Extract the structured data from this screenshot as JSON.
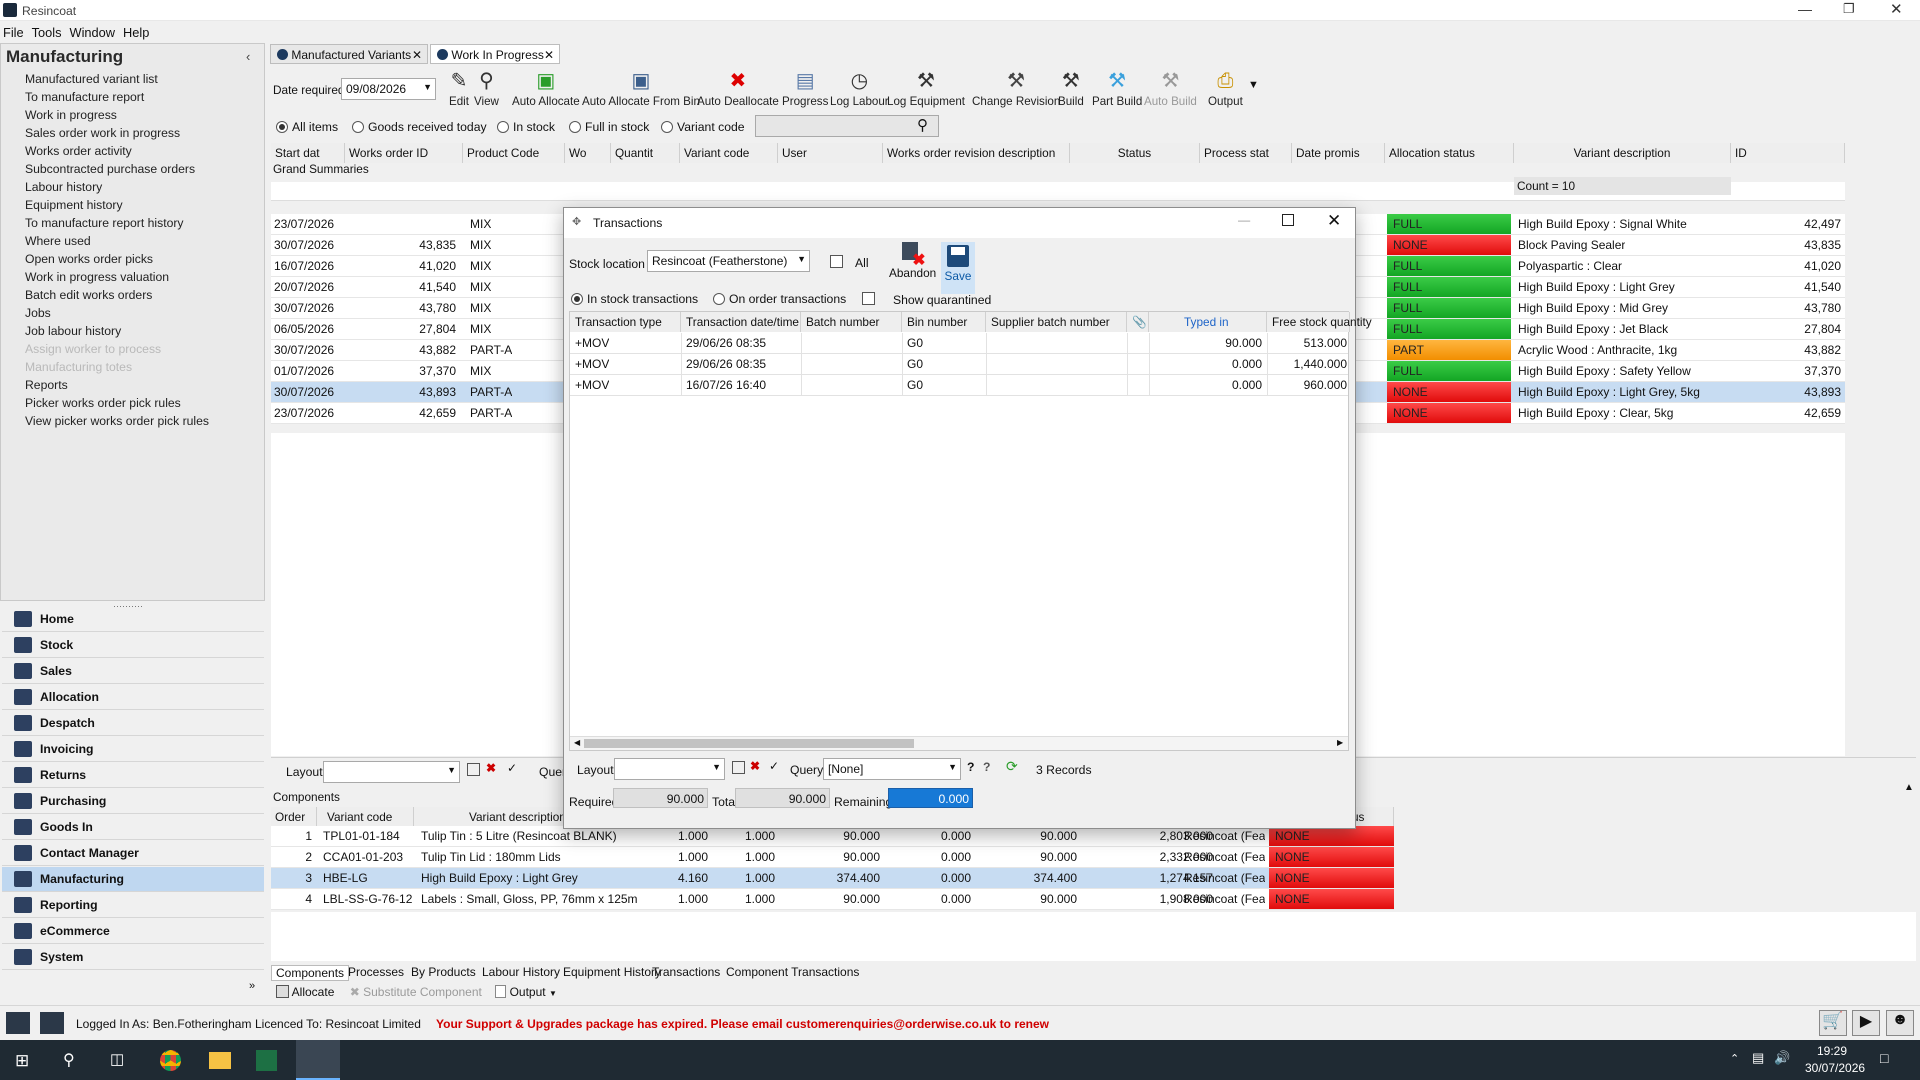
{
  "window": {
    "title": "Resincoat"
  },
  "menu": [
    "File",
    "Tools",
    "Window",
    "Help"
  ],
  "left": {
    "title": "Manufacturing",
    "items": [
      "Manufactured variant list",
      "To manufacture report",
      "Work in progress",
      "Sales order work in progress",
      "Works order activity",
      "Subcontracted purchase orders",
      "Labour history",
      "Equipment history",
      "To manufacture report history",
      "Where used",
      "Open works order picks",
      "Work in progress valuation",
      "Batch edit works orders",
      "Jobs",
      "Job labour history",
      "Assign worker to process",
      "Manufacturing totes",
      "Reports",
      "Picker works order pick rules",
      "View picker works order pick rules"
    ],
    "disabled": [
      15,
      16
    ],
    "modules": [
      "Home",
      "Stock",
      "Sales",
      "Allocation",
      "Despatch",
      "Invoicing",
      "Returns",
      "Purchasing",
      "Goods In",
      "Contact Manager",
      "Manufacturing",
      "Reporting",
      "eCommerce",
      "System"
    ]
  },
  "tabs": [
    "Manufactured Variants",
    "Work In Progress"
  ],
  "toolbar": {
    "date_label": "Date required",
    "date_value": "09/08/2026",
    "buttons": [
      "Edit",
      "View",
      "Auto Allocate",
      "Auto Allocate From Bin",
      "Auto Deallocate",
      "Progress",
      "Log Labour",
      "Log Equipment",
      "Change Revision",
      "Build",
      "Part Build",
      "Auto Build",
      "Output"
    ]
  },
  "filters": [
    "All items",
    "Goods received today",
    "In stock",
    "Full in stock",
    "Variant code"
  ],
  "grid": {
    "headers": [
      "Start dat",
      "Works order ID",
      "Product Code",
      "Wo",
      "Quantit",
      "Variant code",
      "User",
      "Works order revision description",
      "Status",
      "Process stat",
      "Date promis",
      "Allocation status",
      "Variant description",
      "ID"
    ],
    "grand": "Grand Summaries",
    "count": "Count = 10",
    "rows": [
      {
        "date": "23/07/2026",
        "woid": "",
        "code": "MIX",
        "alloc": "FULL",
        "color": "green",
        "desc": "High Build Epoxy : Signal White",
        "id": "42,497"
      },
      {
        "date": "30/07/2026",
        "woid": "43,835",
        "code": "MIX",
        "alloc": "NONE",
        "color": "red",
        "desc": "Block Paving Sealer",
        "id": "43,835"
      },
      {
        "date": "16/07/2026",
        "woid": "41,020",
        "code": "MIX",
        "alloc": "FULL",
        "color": "green",
        "desc": "Polyaspartic : Clear",
        "id": "41,020"
      },
      {
        "date": "20/07/2026",
        "woid": "41,540",
        "code": "MIX",
        "alloc": "FULL",
        "color": "green",
        "desc": "High Build Epoxy : Light Grey",
        "id": "41,540"
      },
      {
        "date": "30/07/2026",
        "woid": "43,780",
        "code": "MIX",
        "alloc": "FULL",
        "color": "green",
        "desc": "High Build Epoxy : Mid Grey",
        "id": "43,780"
      },
      {
        "date": "06/05/2026",
        "woid": "27,804",
        "code": "MIX",
        "alloc": "FULL",
        "color": "green",
        "desc": "High Build Epoxy : Jet Black",
        "id": "27,804"
      },
      {
        "date": "30/07/2026",
        "woid": "43,882",
        "code": "PART-A",
        "alloc": "PART",
        "color": "orange",
        "desc": "Acrylic Wood : Anthracite, 1kg",
        "id": "43,882"
      },
      {
        "date": "01/07/2026",
        "woid": "37,370",
        "code": "MIX",
        "alloc": "FULL",
        "color": "green",
        "desc": "High Build Epoxy : Safety Yellow",
        "id": "37,370"
      },
      {
        "date": "30/07/2026",
        "woid": "43,893",
        "code": "PART-A",
        "alloc": "NONE",
        "color": "red",
        "desc": "High Build Epoxy : Light Grey, 5kg",
        "id": "43,893"
      },
      {
        "date": "23/07/2026",
        "woid": "42,659",
        "code": "PART-A",
        "alloc": "NONE",
        "color": "red",
        "desc": "High Build Epoxy : Clear, 5kg",
        "id": "42,659"
      }
    ],
    "selected": 8
  },
  "layout_label": "Layout:",
  "query_label": "Quer",
  "components": {
    "title": "Components",
    "headers": [
      "Order",
      "Variant code",
      "Variant description",
      "us"
    ],
    "rows": [
      {
        "order": "1",
        "code": "TPL01-01-184",
        "desc": "Tulip Tin : 5 Litre (Resincoat BLANK)",
        "a": "1.000",
        "b": "1.000",
        "c": "90.000",
        "d": "0.000",
        "e": "90.000",
        "f": "2,803.000",
        "loc": "Resincoat (Fea",
        "st": "NONE"
      },
      {
        "order": "2",
        "code": "CCA01-01-203",
        "desc": "Tulip Tin Lid : 180mm Lids",
        "a": "1.000",
        "b": "1.000",
        "c": "90.000",
        "d": "0.000",
        "e": "90.000",
        "f": "2,332.000",
        "loc": "Resincoat (Fea",
        "st": "NONE"
      },
      {
        "order": "3",
        "code": "HBE-LG",
        "desc": "High Build Epoxy : Light Grey",
        "a": "4.160",
        "b": "1.000",
        "c": "374.400",
        "d": "0.000",
        "e": "374.400",
        "f": "1,274.157",
        "loc": "Resincoat (Fea",
        "st": "NONE"
      },
      {
        "order": "4",
        "code": "LBL-SS-G-76-12",
        "desc": "Labels : Small, Gloss, PP, 76mm x 125m",
        "a": "1.000",
        "b": "1.000",
        "c": "90.000",
        "d": "0.000",
        "e": "90.000",
        "f": "1,908.000",
        "loc": "Resincoat (Fea",
        "st": "NONE"
      }
    ],
    "selected": 2,
    "tabs": [
      "Components",
      "Processes",
      "By Products",
      "Labour History",
      "Equipment History",
      "Transactions",
      "Component Transactions"
    ],
    "actions": [
      "Allocate",
      "Substitute Component",
      "Output"
    ]
  },
  "dialog": {
    "title": "Transactions",
    "stock_label": "Stock location",
    "stock_value": "Resincoat (Featherstone)",
    "all_label": "All",
    "abandon": "Abandon",
    "save": "Save",
    "radio": [
      "In stock transactions",
      "On order transactions"
    ],
    "quarantine": "Show quarantined",
    "headers": [
      "Transaction type",
      "Transaction date/time",
      "Batch number",
      "Bin number",
      "Supplier batch number",
      "",
      "Typed in",
      "Free stock quantity"
    ],
    "rows": [
      {
        "type": "+MOV",
        "dt": "29/06/26 08:35",
        "batch": "",
        "bin": "G0",
        "sup": "",
        "typed": "90.000",
        "free": "513.000"
      },
      {
        "type": "+MOV",
        "dt": "29/06/26 08:35",
        "batch": "",
        "bin": "G0",
        "sup": "",
        "typed": "0.000",
        "free": "1,440.000"
      },
      {
        "type": "+MOV",
        "dt": "16/07/26 16:40",
        "batch": "",
        "bin": "G0",
        "sup": "",
        "typed": "0.000",
        "free": "960.000"
      }
    ],
    "layout": "Layout:",
    "query": "Query:",
    "query_value": "[None]",
    "records": "3 Records",
    "required_label": "Required",
    "required": "90.000",
    "total_label": "Total",
    "total": "90.000",
    "remaining_label": "Remaining",
    "remaining": "0.000"
  },
  "status": {
    "user": "Logged In As: Ben.Fotheringham",
    "licence": "Licenced To: Resincoat Limited",
    "warning": "Your Support & Upgrades package has expired. Please email customerenquiries@orderwise.co.uk to renew"
  },
  "clock": {
    "time": "19:29",
    "date": "30/07/2026"
  },
  "colors": {
    "accent": "#0078d7",
    "full": "#22b430",
    "none": "#ee1c1c",
    "part": "#f6a21c",
    "selected": "#c7dcf2",
    "warning": "#d00000"
  }
}
